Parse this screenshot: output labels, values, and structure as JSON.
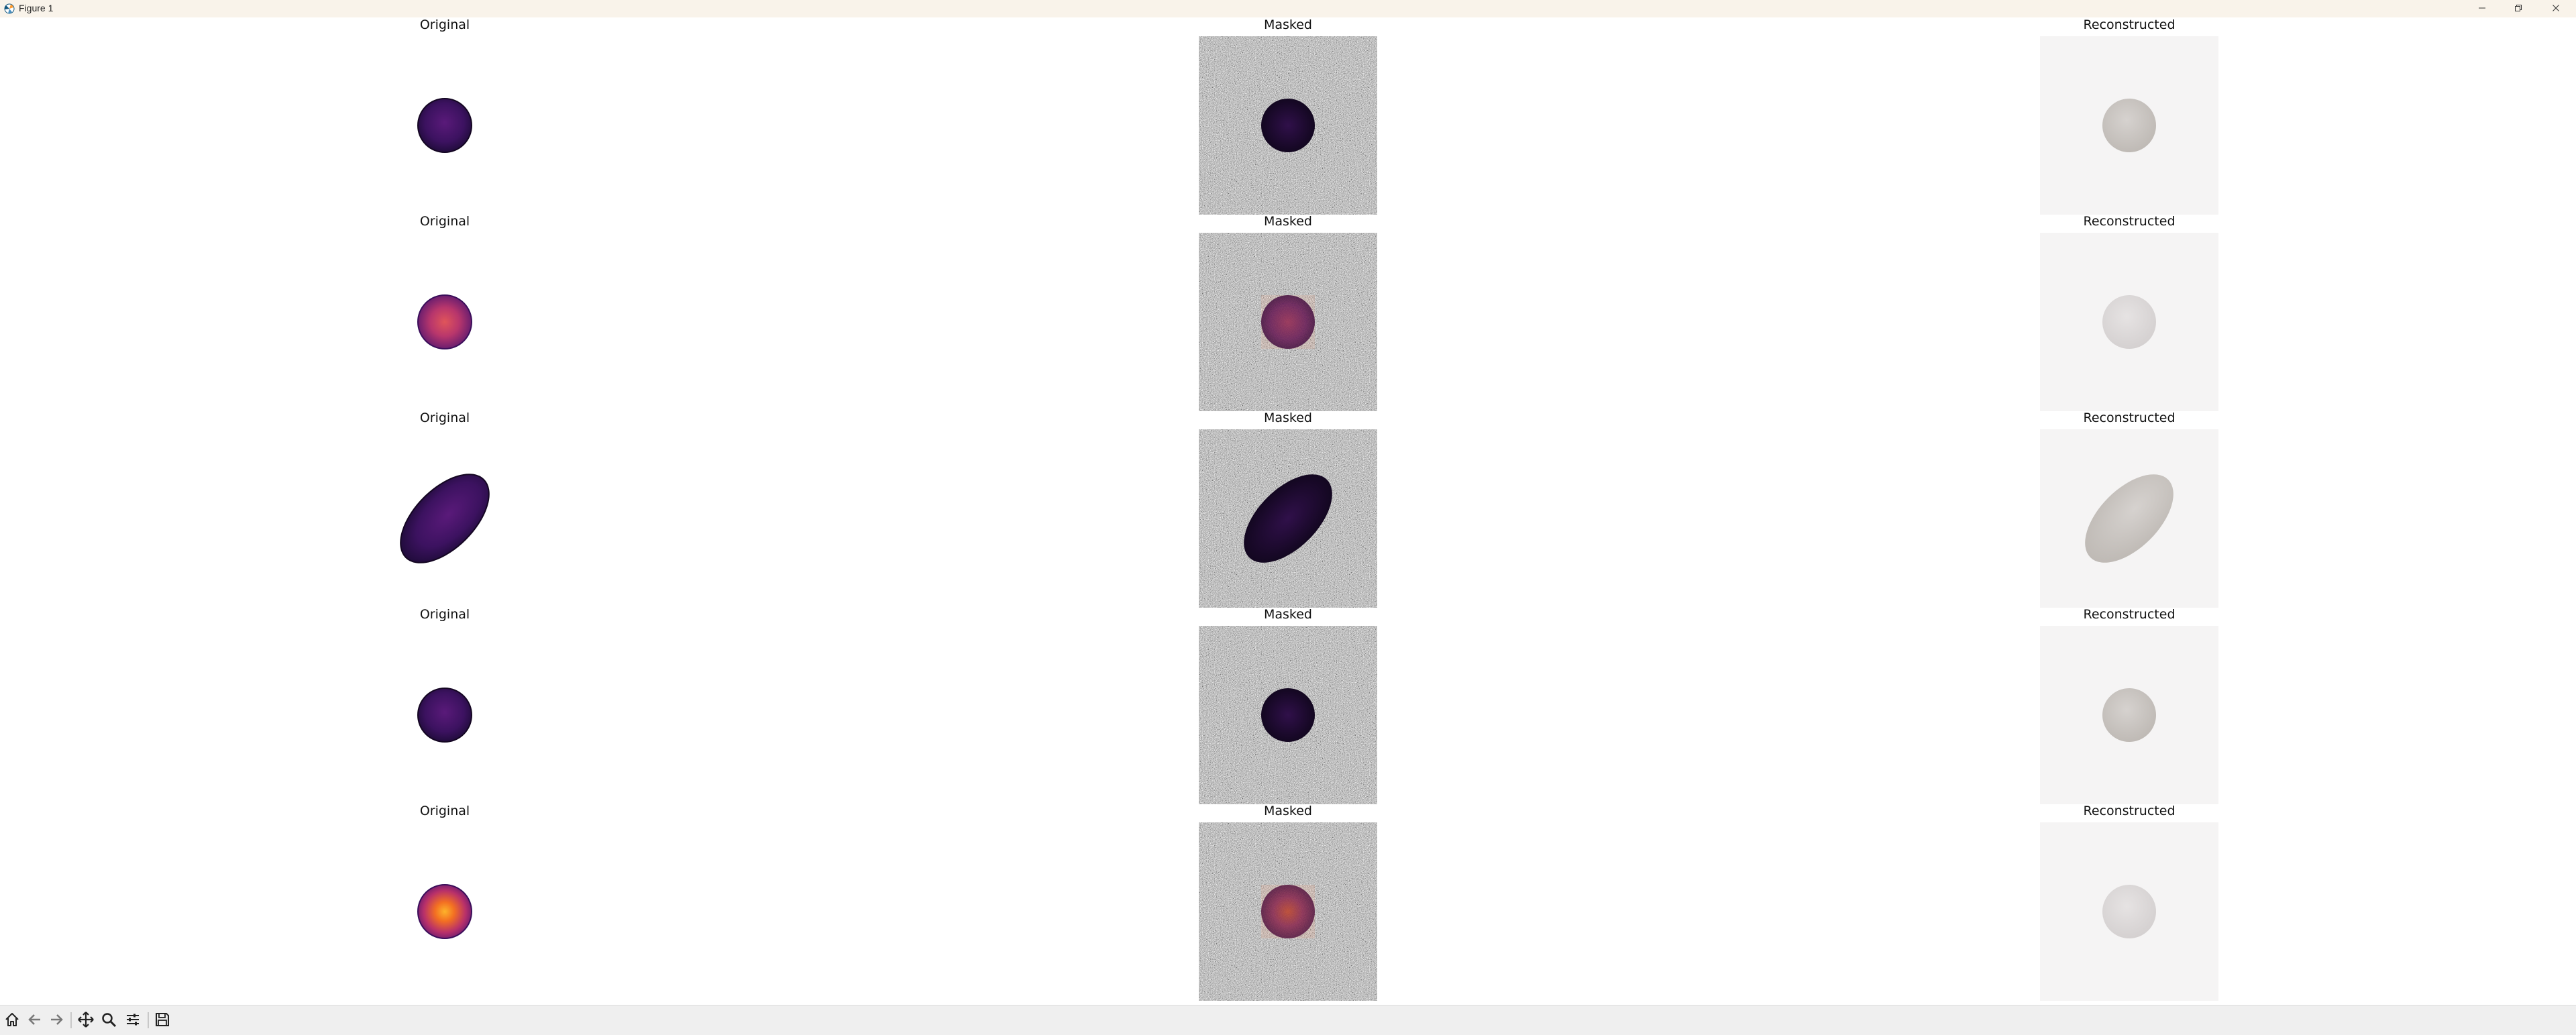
{
  "window": {
    "title": "Figure 1",
    "icon": "matplotlib-logo-icon",
    "controls": [
      "minimize-icon",
      "restore-icon",
      "close-icon"
    ]
  },
  "figure": {
    "rows": [
      {
        "original_label": "Original",
        "masked_label": "Masked",
        "reconstructed_label": "Reconstructed",
        "shape": "circle",
        "colormap": "inferno-dark"
      },
      {
        "original_label": "Original",
        "masked_label": "Masked",
        "reconstructed_label": "Reconstructed",
        "shape": "circle",
        "colormap": "inferno-mid"
      },
      {
        "original_label": "Original",
        "masked_label": "Masked",
        "reconstructed_label": "Reconstructed",
        "shape": "ellipse",
        "colormap": "inferno-dark"
      },
      {
        "original_label": "Original",
        "masked_label": "Masked",
        "reconstructed_label": "Reconstructed",
        "shape": "circle",
        "colormap": "inferno-dark"
      },
      {
        "original_label": "Original",
        "masked_label": "Masked",
        "reconstructed_label": "Reconstructed",
        "shape": "circle",
        "colormap": "inferno-bright"
      }
    ]
  },
  "toolbar": {
    "buttons": [
      "home-icon",
      "back-icon",
      "forward-icon",
      "pan-icon",
      "zoom-icon",
      "configure-subplots-icon",
      "save-icon"
    ]
  },
  "colors": {
    "titlebar": "#f9f3ea",
    "toolbar": "#efefef",
    "noise_mid": "#8a8a8a"
  }
}
